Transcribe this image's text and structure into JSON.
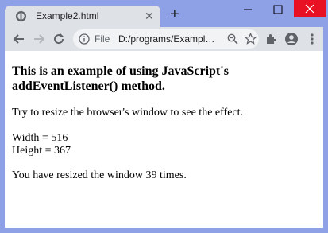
{
  "tab": {
    "title": "Example2.html",
    "close_glyph": "✕"
  },
  "new_tab_glyph": "+",
  "omnibox": {
    "scheme_label": "File",
    "url": "D:/programs/Exampl…"
  },
  "page": {
    "heading": "This is an example of using JavaScript's addEventListener() method.",
    "instruction": "Try to resize the browser's window to see the effect.",
    "width_line": "Width = 516",
    "height_line": "Height = 367",
    "resize_message": "You have resized the window 39 times."
  },
  "colors": {
    "frame": "#8ea0e6",
    "toolbar": "#dee1e6",
    "close_red": "#e81123"
  },
  "icons": [
    "globe-icon",
    "close-icon",
    "plus-icon",
    "minimize-icon",
    "maximize-icon",
    "window-close-icon",
    "back-arrow-icon",
    "forward-arrow-icon",
    "reload-icon",
    "info-icon",
    "zoom-icon",
    "star-icon",
    "extensions-icon",
    "profile-icon",
    "menu-icon"
  ]
}
